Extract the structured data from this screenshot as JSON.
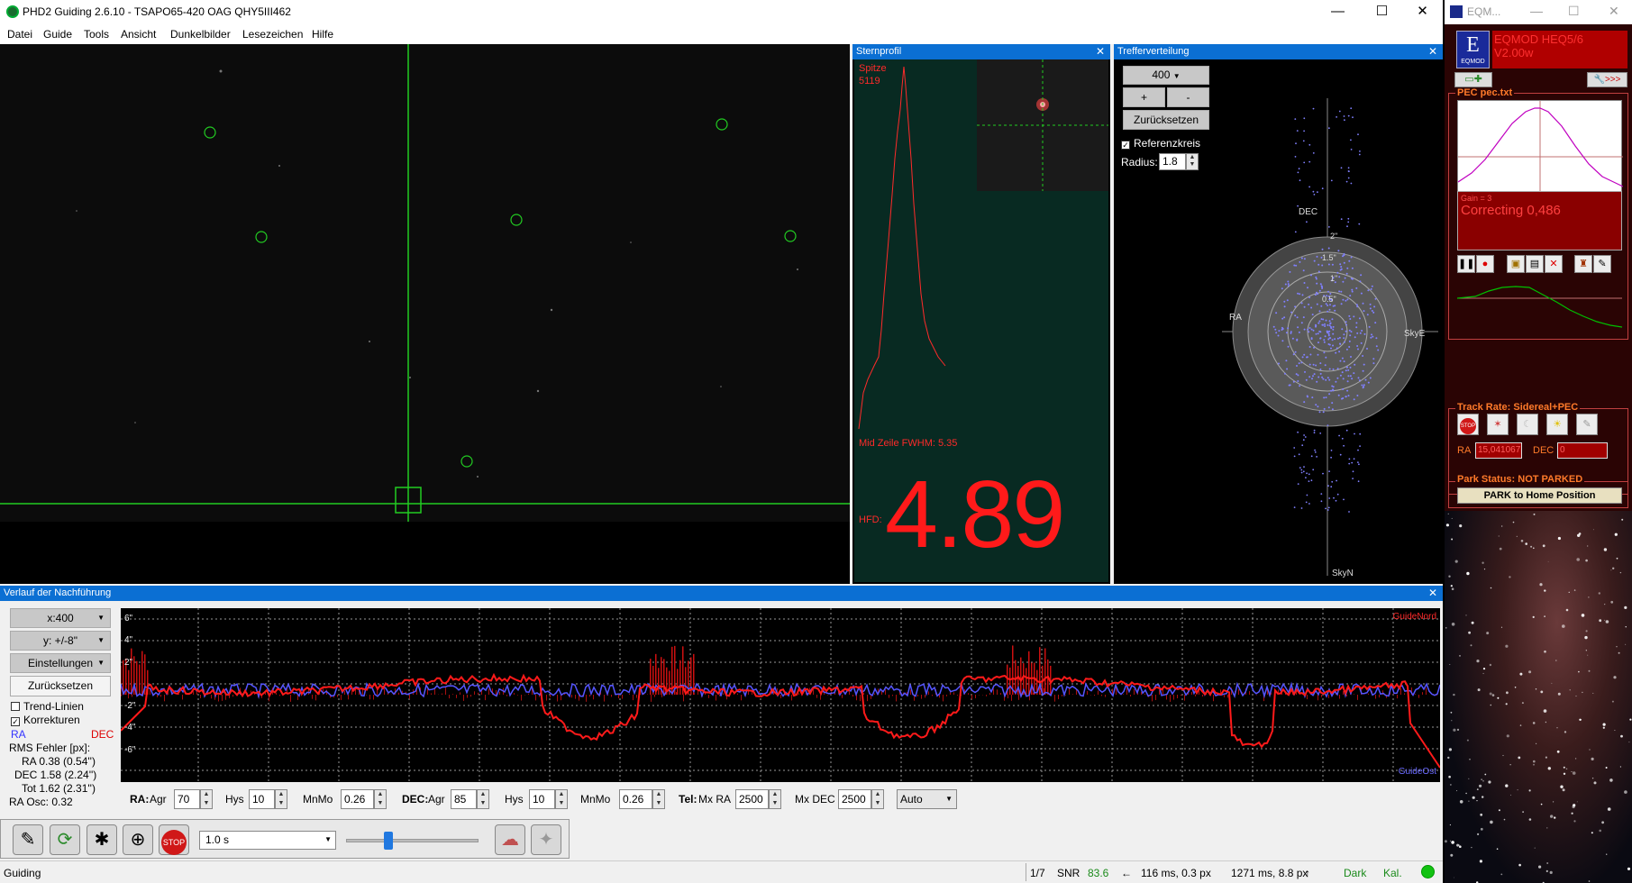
{
  "phd": {
    "title": "PHD2 Guiding 2.6.10 - TSAPO65-420 OAG QHY5III462",
    "menu": [
      "Datei",
      "Guide",
      "Tools",
      "Ansicht",
      "Dunkelbilder",
      "Lesezeichen",
      "Hilfe"
    ],
    "window_controls": {
      "minimize": "—",
      "maximize": "☐",
      "close": "✕"
    }
  },
  "star_profile": {
    "title": "Sternprofil",
    "peak_label": "Spitze",
    "peak_value": "5119",
    "fwhm_text": "Mid Zeile FWHM: 5.35",
    "hfd_label": "HFD:",
    "hfd_value": "4.89",
    "close": "✕"
  },
  "target": {
    "title": "Trefferverteilung",
    "zoom_select": "400",
    "plus": "+",
    "minus": "-",
    "reset": "Zurücksetzen",
    "refcircle_label": "Referenzkreis",
    "radius_label": "Radius:",
    "radius_value": "1.8",
    "axis_dec": "DEC",
    "axis_ra": "RA",
    "axis_skye": "SkyE",
    "axis_skyn": "SkyN",
    "ring_labels": [
      "2\"",
      "1.5\"",
      "1\"",
      "0.5\""
    ],
    "close": "✕"
  },
  "history": {
    "title": "Verlauf der Nachführung",
    "close": "✕",
    "x_select": "x:400",
    "y_select": "y: +/-8\"",
    "settings": "Einstellungen",
    "reset": "Zurücksetzen",
    "trend_label": "Trend-Linien",
    "corrections_label": "Korrekturen",
    "ra_label": "RA",
    "dec_label": "DEC",
    "rms_title": "RMS Fehler [px]:",
    "rms_ra": "RA  0.38 (0.54'')",
    "rms_dec": "DEC  1.58 (2.24'')",
    "rms_tot": "Tot  1.62 (2.31'')",
    "ra_osc": "RA Osc: 0.32",
    "graph_y_labels": [
      "6\"",
      "4\"",
      "2\"",
      "-2\"",
      "-4\"",
      "-6\""
    ],
    "guide_nord": "GuideNord",
    "guide_ost": "GuideOst",
    "colors": {
      "ra": "#5555ff",
      "dec": "#ff1a1a",
      "grid": "#888888"
    }
  },
  "params": {
    "ra_label": "RA:",
    "agr_label": "Agr",
    "agr_ra": "70",
    "hys_label": "Hys",
    "hys": "10",
    "mnmo_label": "MnMo",
    "mnmo_ra": "0.26",
    "dec_label": "DEC:",
    "agr_dec": "85",
    "hys_dec": "10",
    "mnmo_dec": "0.26",
    "tel_label": "Tel:",
    "mx_ra_label": "Mx RA",
    "mx_ra": "2500",
    "mx_dec_label": "Mx DEC",
    "mx_dec": "2500",
    "dec_mode": "Auto"
  },
  "toolbar": {
    "exposure": "1.0 s",
    "stop_label": "STOP"
  },
  "status": {
    "text": "Guiding",
    "frame": "1/7",
    "snr_label": "SNR",
    "snr_value": "83.6",
    "pulse_ra": "116 ms, 0.3 px",
    "pulse_dec": "1271 ms, 8.8 px",
    "dark": "Dark",
    "cal": "Kal."
  },
  "eqmod": {
    "title": "EQM...",
    "logo_letter": "E",
    "logo_text": "EQMOD",
    "mount": "EQMOD HEQ5/6",
    "version": "V2.00w",
    "pec_title": "PEC pec.txt",
    "gain_text": "Gain = 3",
    "correcting": "Correcting 0,486",
    "track_title": "Track Rate: Sidereal+PEC",
    "ra_label": "RA",
    "ra_value": "15,041067",
    "dec_label": "DEC",
    "dec_value": "0",
    "park_title": "Park Status: NOT PARKED",
    "park_button": "PARK to Home Position",
    "stop_label": "STOP"
  }
}
